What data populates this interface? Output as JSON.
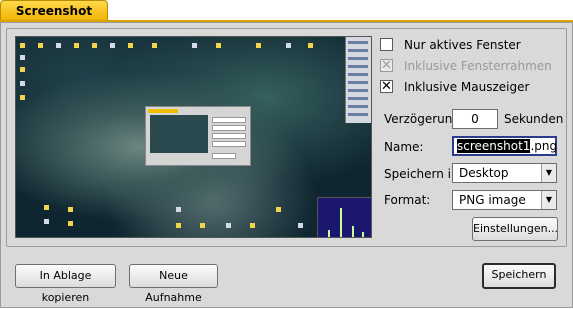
{
  "window": {
    "tab_title": "Screenshot"
  },
  "options": {
    "only_active_window": {
      "label": "Nur aktives Fenster",
      "checked": false,
      "enabled": true
    },
    "include_window_frame": {
      "label": "Inklusive Fensterrahmen",
      "checked": true,
      "enabled": false
    },
    "include_mouse_pointer": {
      "label": "Inklusive Mauszeiger",
      "checked": true,
      "enabled": true
    }
  },
  "delay": {
    "label": "Verzögerung:",
    "value": "0",
    "unit": "Sekunden"
  },
  "name": {
    "label": "Name:",
    "selected_part": "screenshot1",
    "rest": ".png"
  },
  "save_in": {
    "label": "Speichern in:",
    "value": "Desktop"
  },
  "format": {
    "label": "Format:",
    "value": "PNG image"
  },
  "buttons": {
    "settings": "Einstellungen...",
    "copy_clipboard": "In Ablage kopieren",
    "new_capture": "Neue Aufnahme",
    "save": "Speichern"
  }
}
